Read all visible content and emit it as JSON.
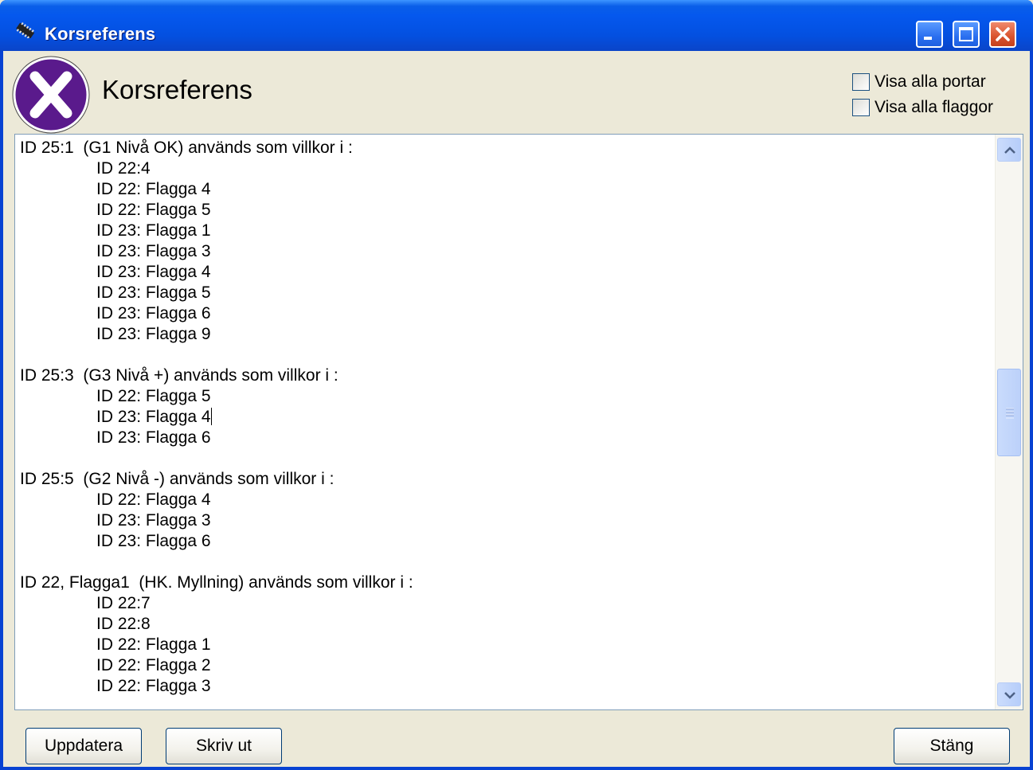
{
  "window": {
    "title": "Korsreferens"
  },
  "header": {
    "title": "Korsreferens",
    "logo_icon": "x-logo-icon",
    "checkboxes": [
      {
        "label": "Visa alla portar",
        "checked": false
      },
      {
        "label": "Visa alla flaggor",
        "checked": false
      }
    ]
  },
  "content": {
    "blocks": [
      {
        "heading": "ID 25:1  (G1 Nivå OK) används som villkor i :",
        "items": [
          "ID 22:4",
          "ID 22: Flagga 4",
          "ID 22: Flagga 5",
          "ID 23: Flagga 1",
          "ID 23: Flagga 3",
          "ID 23: Flagga 4",
          "ID 23: Flagga 5",
          "ID 23: Flagga 6",
          "ID 23: Flagga 9"
        ]
      },
      {
        "heading": "ID 25:3  (G3 Nivå +) används som villkor i :",
        "items": [
          "ID 22: Flagga 5",
          "ID 23: Flagga 4",
          "ID 23: Flagga 6"
        ]
      },
      {
        "heading": "ID 25:5  (G2 Nivå -) används som villkor i :",
        "items": [
          "ID 22: Flagga 4",
          "ID 23: Flagga 3",
          "ID 23: Flagga 6"
        ]
      },
      {
        "heading": "ID 22, Flagga1  (HK. Myllning) används som villkor i :",
        "items": [
          "ID 22:7",
          "ID 22:8",
          "ID 22: Flagga 1",
          "ID 22: Flagga 2",
          "ID 22: Flagga 3"
        ]
      }
    ]
  },
  "footer": {
    "update_label": "Uppdatera",
    "print_label": "Skriv ut",
    "close_label": "Stäng"
  }
}
